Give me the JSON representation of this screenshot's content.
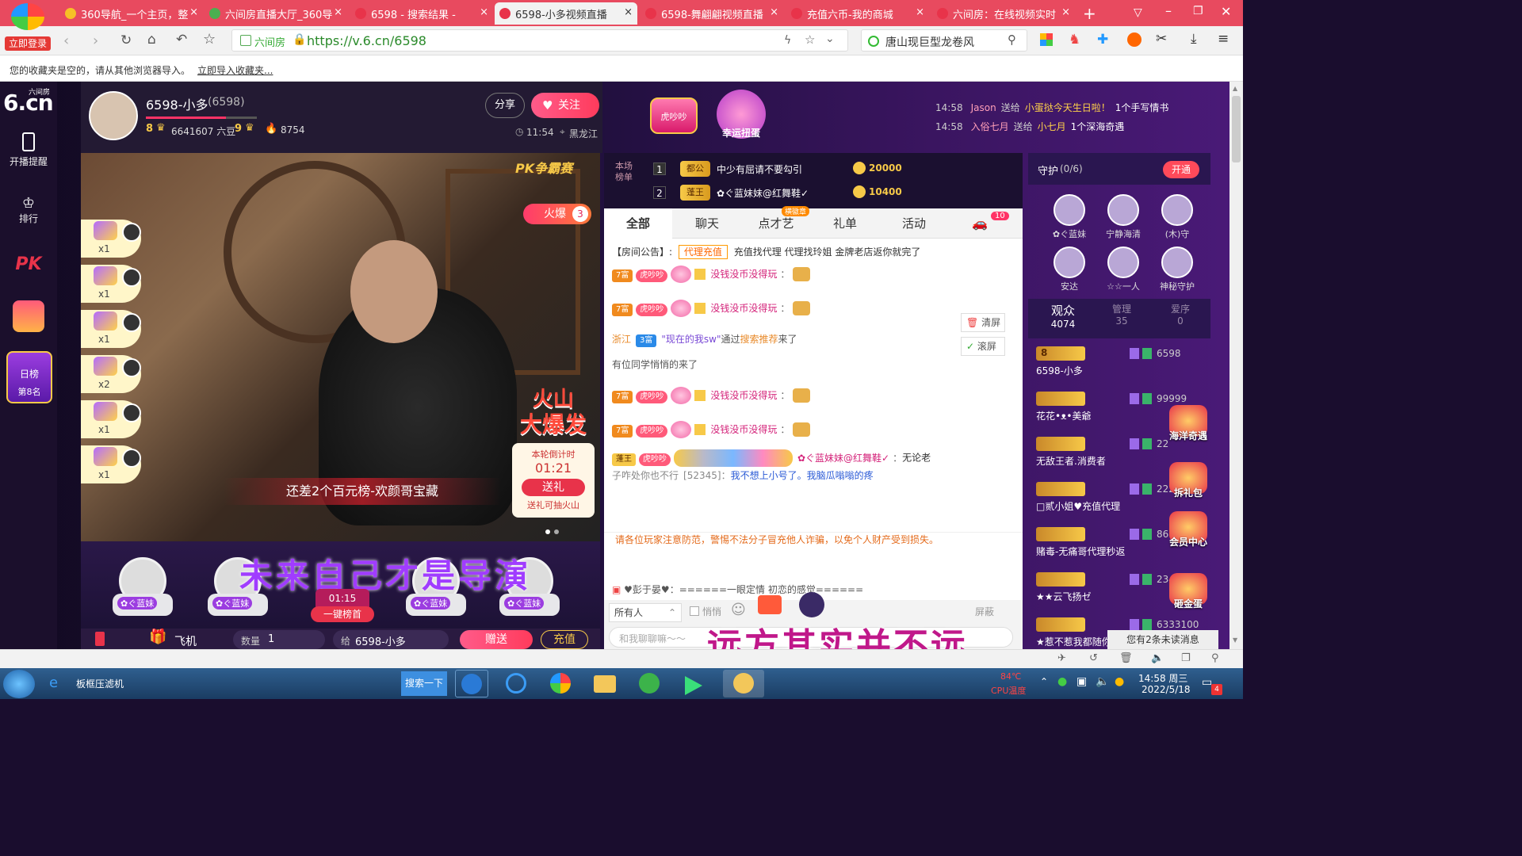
{
  "browser": {
    "login_label": "立即登录",
    "tabs": [
      {
        "title": "360导航_一个主页，整",
        "color": "#f6c026"
      },
      {
        "title": "六间房直播大厅_360导",
        "color": "#4caf50"
      },
      {
        "title": "6598 - 搜索结果 -",
        "color": "#e8334a"
      },
      {
        "title": "6598-小多视频直播",
        "color": "#e8334a"
      },
      {
        "title": "6598-舞翩翩视频直播",
        "color": "#e8334a"
      },
      {
        "title": "充值六币-我的商城",
        "color": "#e8334a"
      },
      {
        "title": "六间房：在线视频实时",
        "color": "#e8334a"
      }
    ],
    "site_name": "六间房",
    "url": "https://v.6.cn/6598",
    "search_text": "唐山现巨型龙卷风",
    "favbar_text": "您的收藏夹是空的，请从其他浏览器导入。",
    "favbar_link": "立即导入收藏夹..."
  },
  "nav": {
    "logo_sub": "六间房",
    "logo": "6.cn",
    "items": [
      "开播提醒",
      "排行"
    ],
    "pk": "PK",
    "daily_label": "日榜",
    "daily_rank": "第8名"
  },
  "streamer": {
    "name": "6598-小多",
    "id": "(6598)",
    "level_left": "8",
    "beans": "6641607 六豆",
    "level_right": "9",
    "fire_count": "8754",
    "share": "分享",
    "follow": "关注",
    "time": "11:54",
    "location": "黑龙江"
  },
  "center_top": {
    "badge": "虎吵吵",
    "lucky": "幸运扭蛋"
  },
  "notices": [
    {
      "time": "14:58",
      "user": "Jason",
      "action": "送给",
      "target": "小蛋挞今天生日啦！",
      "gift": "1个手写情书"
    },
    {
      "time": "14:58",
      "user": "入俗七月",
      "action": "送给",
      "target": "小七月",
      "gift": "1个深海奇遇"
    }
  ],
  "video": {
    "pk_label": "PK争霸赛",
    "hot_label": "火爆",
    "hot_num": "3",
    "gift_counts": [
      "x1",
      "x1",
      "x1",
      "x2",
      "x1",
      "x1"
    ],
    "banner": "还差2个百元榜-欢颜哥宝藏",
    "volcano_title_1": "火山",
    "volcano_title_2": "大爆发",
    "countdown_label": "本轮倒计时",
    "countdown": "01:21",
    "send_btn": "送礼",
    "volcano_hint": "送礼可抽火山"
  },
  "seats": {
    "names": [
      "✿ぐ蓝妹",
      "✿ぐ蓝妹",
      "✿ぐ蓝妹",
      "✿ぐ蓝妹"
    ],
    "overlay": "未来自己才是导演",
    "timer": "01:15",
    "grab": "一键榜首"
  },
  "giftbar": {
    "gift": "飞机",
    "qty_label": "数量",
    "qty": "1",
    "to_label": "给",
    "to": "6598-小多",
    "give": "赠送",
    "recharge": "充值"
  },
  "rank": {
    "title": "本场\n榜单",
    "rows": [
      {
        "num": "1",
        "title": "都公",
        "name": "中少有屈请不要勾引",
        "coins": "20000"
      },
      {
        "num": "2",
        "title": "蓬王",
        "name": "✿ぐ蓝妹妹@红舞鞋✓",
        "coins": "10400"
      }
    ]
  },
  "chat": {
    "tabs": [
      "全部",
      "聊天",
      "点才艺",
      "礼单",
      "活动"
    ],
    "tab_badge": "横徽章",
    "car_badge": "10",
    "announcement_label": "【房间公告】:",
    "announcement_tag": "代理充值",
    "announcement": "充值找代理 代理找玲姐 金牌老店返你就完了",
    "msg_user": "没钱没币没得玩",
    "clear": "清屏",
    "scroll": "滚屏",
    "enter_region": "浙江",
    "enter_level": "3富",
    "enter_user": "\"现在的我sw\"",
    "enter_via": "通过",
    "enter_link": "搜索推荐",
    "enter_tail": "来了",
    "classmate": "有位同学悄悄的来了",
    "fu_level": "7富",
    "fan_badge": "虎吵吵",
    "big_user": "✿ぐ蓝妹妹@红舞鞋✓",
    "big_msg": "无论老",
    "line2_a": "子咋处你也不行",
    "line2_id": "[52345]",
    "line2_b": "我不想上小号了。我脑瓜嗡嗡的疼",
    "warning": "请各位玩家注意防范，警惕不法分子冒充他人诈骗，以免个人财产受到损失。",
    "motto": "♥彭于晏♥：======一眼定情 初恋的感觉======",
    "to_all": "所有人",
    "whisper": "悄悄",
    "input_placeholder": "和我聊聊嘛～～",
    "block": "屏蔽",
    "overlay": "远方其实并不远"
  },
  "right": {
    "guard_title": "守护",
    "guard_count": "(0/6)",
    "open": "开通",
    "guards": [
      "✿ぐ蓝妹",
      "宁静海清",
      "(木)守",
      "安达",
      "☆☆一人",
      "神秘守护"
    ],
    "tabs": [
      {
        "label": "观众",
        "count": "4074"
      },
      {
        "label": "管理",
        "count": "35"
      },
      {
        "label": "爱序",
        "count": "0"
      }
    ],
    "audience": [
      {
        "level": "8",
        "name": "6598-小多",
        "extra": "6598"
      },
      {
        "level": "",
        "name": "花花•ᴥ•美爺",
        "extra": "99999"
      },
      {
        "level": "",
        "name": "无敌王者.消费者",
        "extra": "22"
      },
      {
        "level": "",
        "name": "□贰小姐♥充值代理",
        "extra": "2227"
      },
      {
        "level": "",
        "name": "赌毒-无痛哥代理秒返",
        "extra": "8616"
      },
      {
        "level": "",
        "name": "★★云飞扬ゼ",
        "extra": "2345678"
      },
      {
        "level": "",
        "name": "★惹不惹我都随你★",
        "extra": "6333100"
      }
    ],
    "promos": [
      "海洋奇遇",
      "拆礼包",
      "会员中心",
      "砸金蛋"
    ],
    "unread": "您有2条未读消息"
  },
  "taskbar": {
    "app": "板框压滤机",
    "search": "搜索一下",
    "cpu_temp": "84℃",
    "cpu_label": "CPU温度",
    "time": "14:58 周三",
    "date": "2022/5/18",
    "badge": "4"
  }
}
